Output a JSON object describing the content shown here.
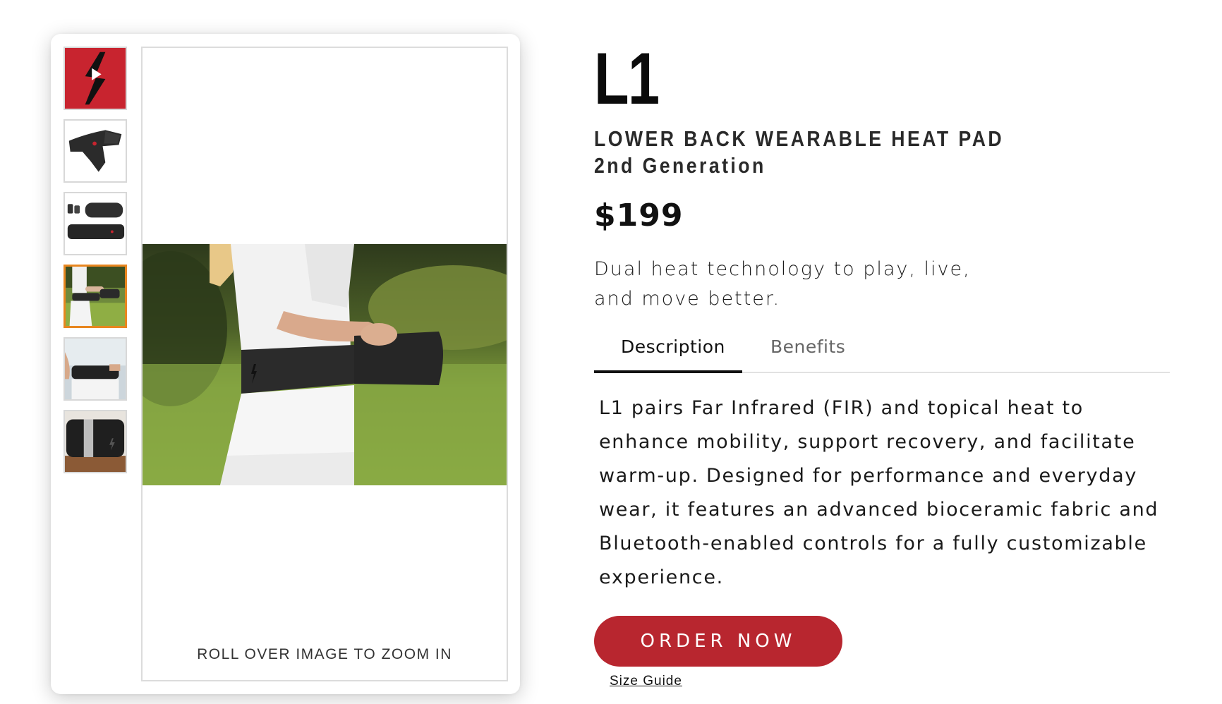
{
  "gallery": {
    "thumbnails": [
      {
        "name": "video-thumbnail-logo",
        "kind": "video"
      },
      {
        "name": "belt-product-thumbnail",
        "kind": "image"
      },
      {
        "name": "belt-and-controller-thumbnail",
        "kind": "image"
      },
      {
        "name": "woman-wearing-belt-thumbnail",
        "kind": "image",
        "selected": true
      },
      {
        "name": "belt-back-view-thumbnail",
        "kind": "image"
      },
      {
        "name": "belt-case-thumbnail",
        "kind": "image"
      }
    ],
    "zoom_hint": "ROLL OVER IMAGE TO ZOOM IN",
    "brand_color": "#c8242f",
    "selected_border_color": "#e8861f"
  },
  "product": {
    "title": "L1",
    "subtitle_line1": "LOWER BACK WEARABLE HEAT PAD",
    "subtitle_line2": "2nd Generation",
    "price": "$199",
    "tagline": "Dual heat technology to play, live, and move better."
  },
  "tabs": {
    "description": "Description",
    "benefits": "Benefits",
    "active": "description"
  },
  "description_text": "L1 pairs Far Infrared (FIR) and topical heat to enhance mobility, support recovery, and facilitate warm-up. Designed for performance and everyday wear, it features an advanced bioceramic fabric and Bluetooth-enabled controls for a fully customizable experience.",
  "actions": {
    "order_label": "ORDER NOW",
    "order_color": "#b8262f",
    "size_guide": "Size Guide"
  }
}
